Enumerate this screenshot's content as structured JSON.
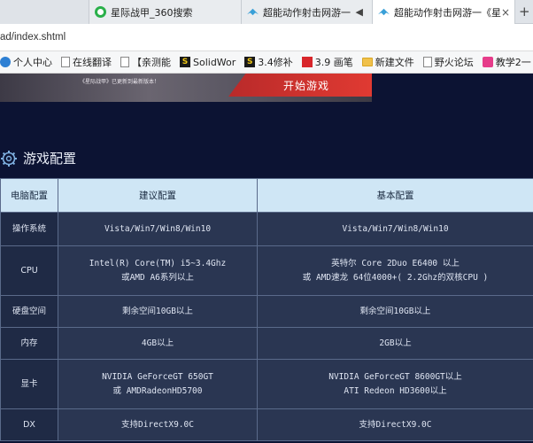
{
  "tabs": [
    {
      "label": "",
      "icon": "partial-tab"
    },
    {
      "label": "星际战甲_360搜索",
      "icon": "360-search-icon"
    },
    {
      "label": "超能动作射击网游一",
      "icon": "bird-logo-icon",
      "speaker": "◀"
    },
    {
      "label": "超能动作射击网游一《星",
      "icon": "bird-logo-icon",
      "close": "×",
      "active": true
    }
  ],
  "new_tab": "+",
  "address": {
    "url": "ad/index.shtml"
  },
  "bookmarks": [
    {
      "label": "个人中心",
      "icon": "person-icon"
    },
    {
      "label": "在线翻译",
      "icon": "page-icon"
    },
    {
      "label": "【亲测能",
      "icon": "page-icon"
    },
    {
      "label": "SolidWor",
      "icon": "solidworks-icon"
    },
    {
      "label": "3.4修补",
      "icon": "solidworks-icon"
    },
    {
      "label": "3.9 画笔",
      "icon": "red-icon"
    },
    {
      "label": "新建文件",
      "icon": "folder-icon"
    },
    {
      "label": "野火论坛",
      "icon": "page-icon"
    },
    {
      "label": "教学2一",
      "icon": "pink-icon"
    }
  ],
  "bookmarks_more": "»",
  "banner": {
    "small_text": "《星际战甲》已更新到最新版本！",
    "start_button": "开始游戏"
  },
  "section": {
    "title": "游戏配置"
  },
  "table": {
    "headers": [
      "电脑配置",
      "建议配置",
      "基本配置"
    ],
    "rows": [
      {
        "label": "操作系统",
        "rec": [
          "Vista/Win7/Win8/Win10"
        ],
        "min": [
          "Vista/Win7/Win8/Win10"
        ]
      },
      {
        "label": "CPU",
        "rec": [
          "Intel(R) Core(TM) i5~3.4Ghz",
          "或AMD A6系列以上"
        ],
        "min": [
          "英特尔 Core 2Duo E6400 以上",
          "或 AMD速龙 64位4000+( 2.2Ghz的双核CPU )"
        ]
      },
      {
        "label": "硬盘空间",
        "rec": [
          "剩余空间10GB以上"
        ],
        "min": [
          "剩余空间10GB以上"
        ]
      },
      {
        "label": "内存",
        "rec": [
          "4GB以上"
        ],
        "min": [
          "2GB以上"
        ]
      },
      {
        "label": "显卡",
        "rec": [
          "NVIDIA GeForceGT 650GT",
          "或 AMDRadeonHD5700"
        ],
        "min": [
          "NVIDIA GeForceGT 8600GT以上",
          "ATI Redeon HD3600以上"
        ]
      },
      {
        "label": "DX",
        "rec": [
          "支持DirectX9.0C"
        ],
        "min": [
          "支持DirectX9.0C"
        ]
      }
    ]
  }
}
